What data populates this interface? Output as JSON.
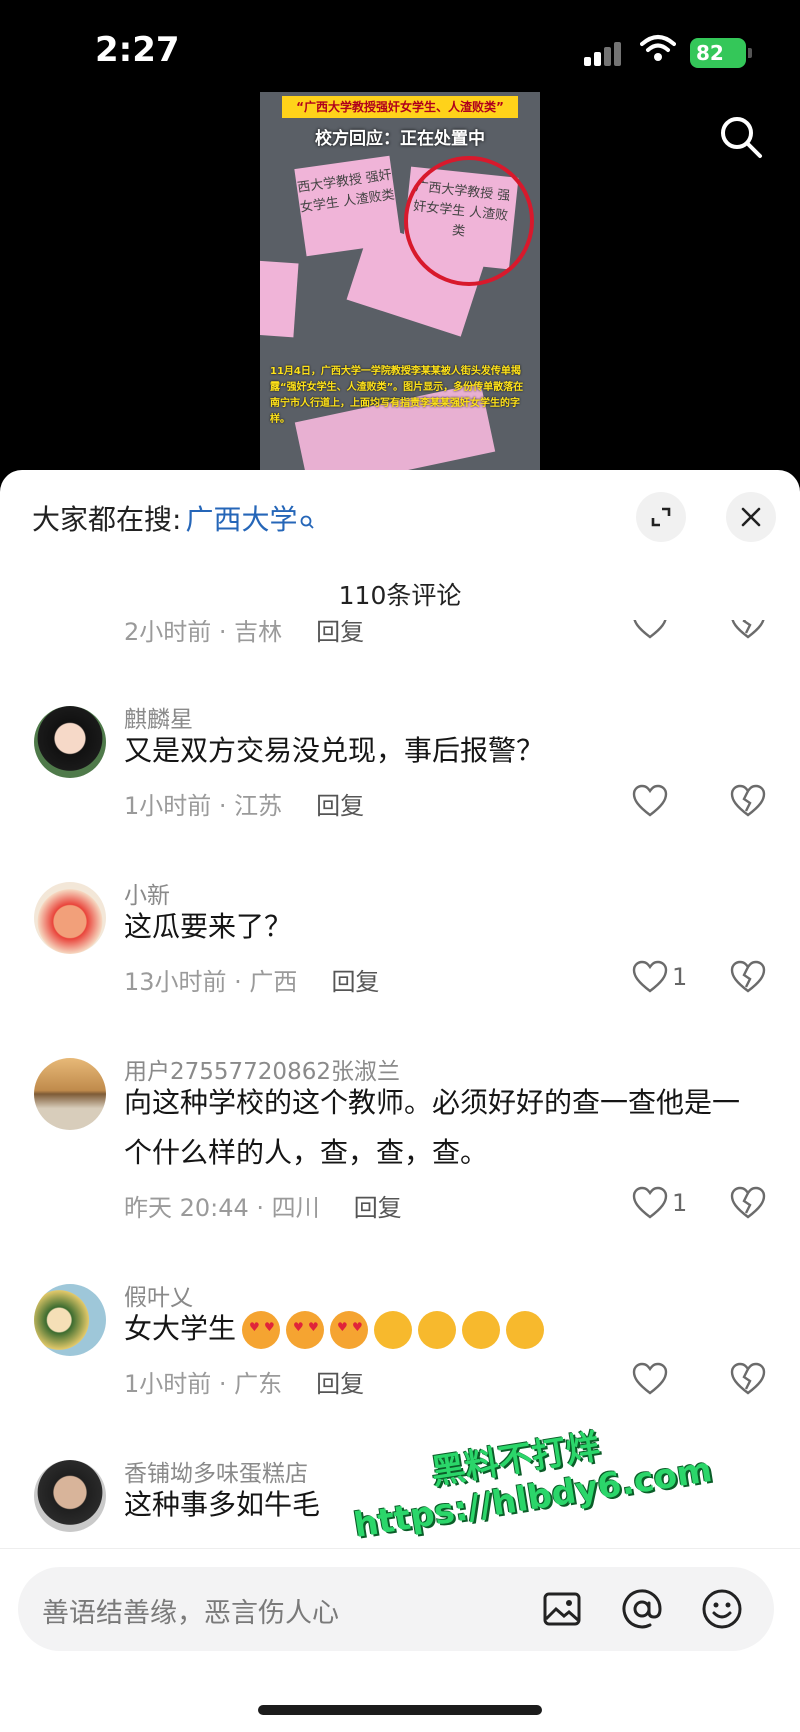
{
  "status_bar": {
    "time": "2:27",
    "battery": "82"
  },
  "video": {
    "headline": "“广西大学教授强奸女学生、人渣败类”",
    "subheadline": "校方回应：正在处置中",
    "caption": "11月4日，广西大学一学院教授李某某被人街头发传单揭露“强奸女学生、人渣败类”。图片显示，多份传单散落在南宁市人行道上，上面均写有指责李某某强奸女学生的字样。",
    "flyer_texts": [
      "西大学教授 强奸女学生 人渣败类",
      "广西大学教授 强奸女学生 人渣败类"
    ]
  },
  "sheet": {
    "hot_search_label": "大家都在搜:",
    "hot_search_term": "广西大学",
    "comment_count": "110条评论"
  },
  "comments": [
    {
      "meta_time_loc": "2小时前 · 吉林",
      "reply": "回复"
    },
    {
      "username": "麒麟星",
      "text": "又是双方交易没兑现，事后报警？",
      "meta_time_loc": "1小时前 · 江苏",
      "reply": "回复"
    },
    {
      "username": "小新",
      "text": "这瓜要来了？",
      "meta_time_loc": "13小时前 · 广西",
      "reply": "回复",
      "likes": "1"
    },
    {
      "username": "用户27557720862张淑兰",
      "text": "向这种学校的这个教师。必须好好的查一查他是一个什么样的人，查，查，查。",
      "meta_time_loc": "昨天 20:44 · 四川",
      "reply": "回复",
      "likes": "1"
    },
    {
      "username": "假叶乂",
      "text": "女大学生",
      "meta_time_loc": "1小时前 · 广东",
      "reply": "回复",
      "emojis": [
        "heart-eyes-emoji",
        "heart-eyes-emoji",
        "heart-eyes-emoji",
        "grin-emoji",
        "grin-emoji",
        "grin-emoji",
        "grin-emoji"
      ]
    },
    {
      "username": "香铺坳多味蛋糕店",
      "text": "这种事多如牛毛"
    }
  ],
  "watermark": {
    "title": "黑料不打烊",
    "url": "https://hlbdy6.com"
  },
  "input": {
    "placeholder": "善语结善缘，恶言伤人心"
  },
  "colors": {
    "accent_link": "#2566b8",
    "battery": "#34c759",
    "watermark": "#2bd66a"
  }
}
